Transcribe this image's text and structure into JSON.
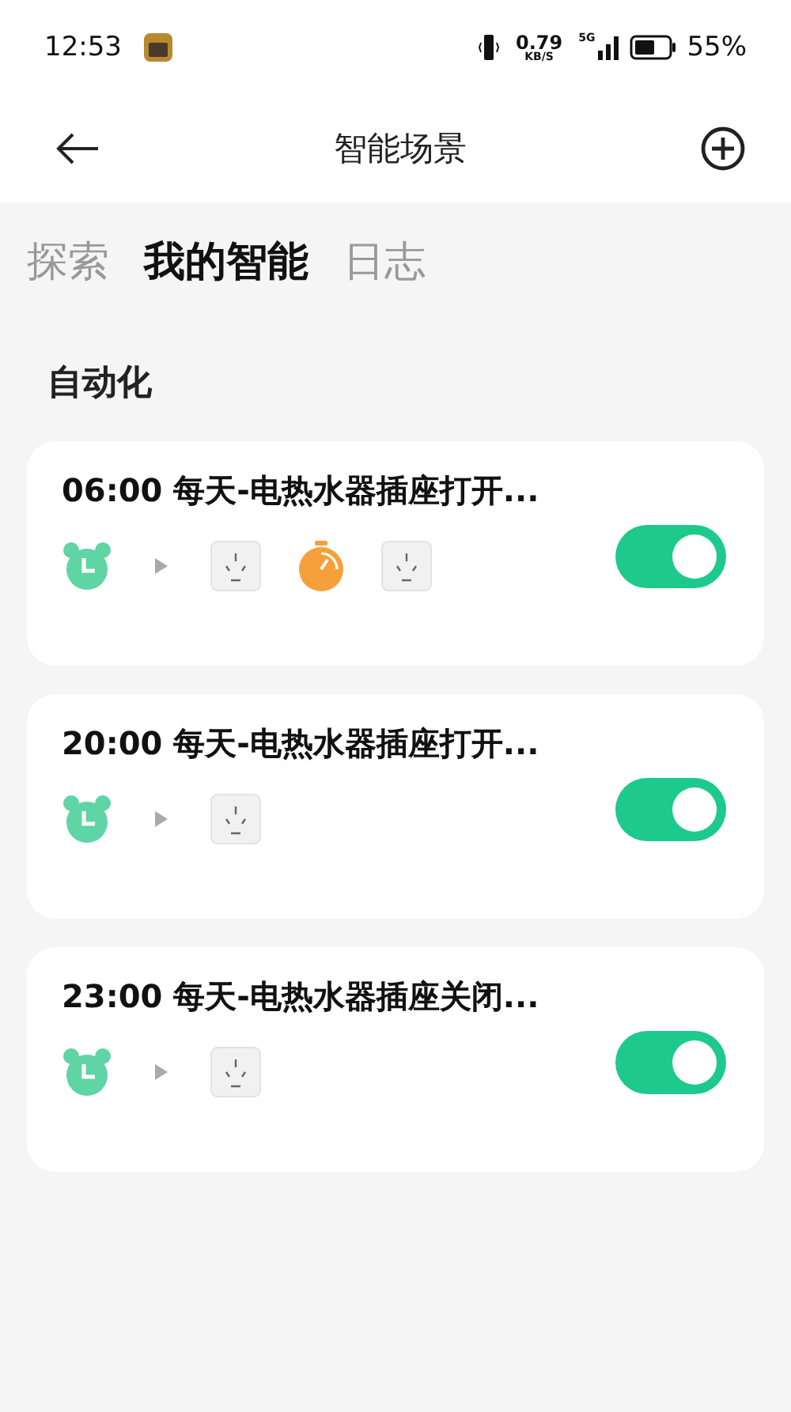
{
  "status_bar": {
    "time": "12:53",
    "speed": "0.79",
    "speed_unit": "KB/S",
    "network": "5G",
    "battery": "55%"
  },
  "header": {
    "title": "智能场景"
  },
  "tabs": [
    {
      "label": "探索",
      "selected": false
    },
    {
      "label": "我的智能",
      "selected": true
    },
    {
      "label": "日志",
      "selected": false
    }
  ],
  "section_title": "自动化",
  "automations": [
    {
      "title": "06:00 每天-电热水器插座打开...",
      "on": true,
      "icons": [
        {
          "kind": "alarm"
        },
        {
          "kind": "arrow"
        },
        {
          "kind": "socket"
        },
        {
          "kind": "timer"
        },
        {
          "kind": "socket"
        }
      ]
    },
    {
      "title": "20:00 每天-电热水器插座打开...",
      "on": true,
      "icons": [
        {
          "kind": "alarm"
        },
        {
          "kind": "arrow"
        },
        {
          "kind": "socket"
        }
      ]
    },
    {
      "title": "23:00 每天-电热水器插座关闭...",
      "on": true,
      "icons": [
        {
          "kind": "alarm"
        },
        {
          "kind": "arrow"
        },
        {
          "kind": "socket"
        }
      ]
    }
  ]
}
